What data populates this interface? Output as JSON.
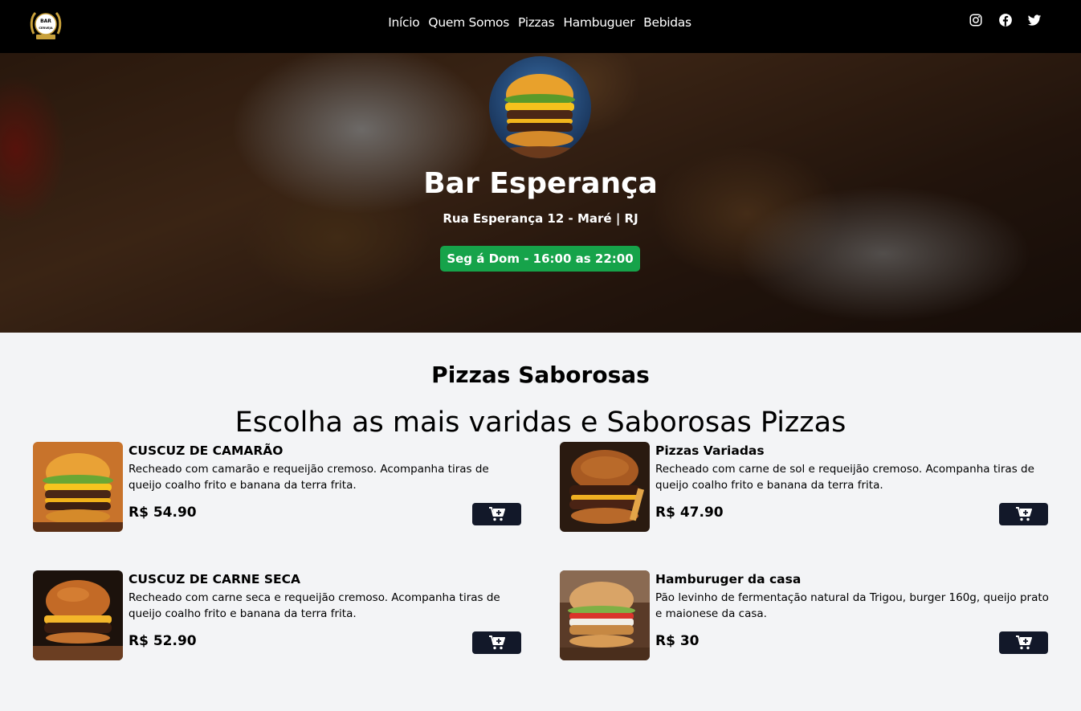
{
  "header": {
    "logo_text_top": "BAR",
    "logo_text_bottom": "CERVEJA",
    "nav": [
      "Início",
      "Quem Somos",
      "Pizzas",
      "Hambuguer",
      "Bebidas"
    ],
    "social_icons": [
      "instagram-icon",
      "facebook-icon",
      "twitter-icon"
    ]
  },
  "hero": {
    "title": "Bar Esperança",
    "address": "Rua Esperança 12 - Maré | RJ",
    "hours": "Seg á Dom - 16:00 as 22:00"
  },
  "menu": {
    "title": "Pizzas Saborosas",
    "subtitle": "Escolha as mais varidas e Saborosas Pizzas",
    "items": [
      {
        "name": "CUSCUZ DE CAMARÃO",
        "description": "Recheado com camarão e requeijão cremoso. Acompanha tiras de queijo coalho frito e banana da terra frita.",
        "price": "R$ 54.90"
      },
      {
        "name": "Pizzas Variadas",
        "description": "Recheado com carne de sol e requeijão cremoso. Acompanha tiras de queijo coalho frito e banana da terra frita.",
        "price": "R$ 47.90"
      },
      {
        "name": "CUSCUZ DE CARNE SECA",
        "description": "Recheado com carne seca e requeijão cremoso. Acompanha tiras de queijo coalho frito e banana da terra frita.",
        "price": "R$ 52.90"
      },
      {
        "name": "Hamburuger da casa",
        "description": "Pão levinho de fermentação natural da Trigou, burger 160g, queijo prato e maionese da casa.",
        "price": "R$ 30"
      }
    ]
  },
  "colors": {
    "topbar": "#000000",
    "hours_badge": "#16a34a",
    "cart_button": "#121829",
    "page_bg": "#f3f4f6"
  }
}
